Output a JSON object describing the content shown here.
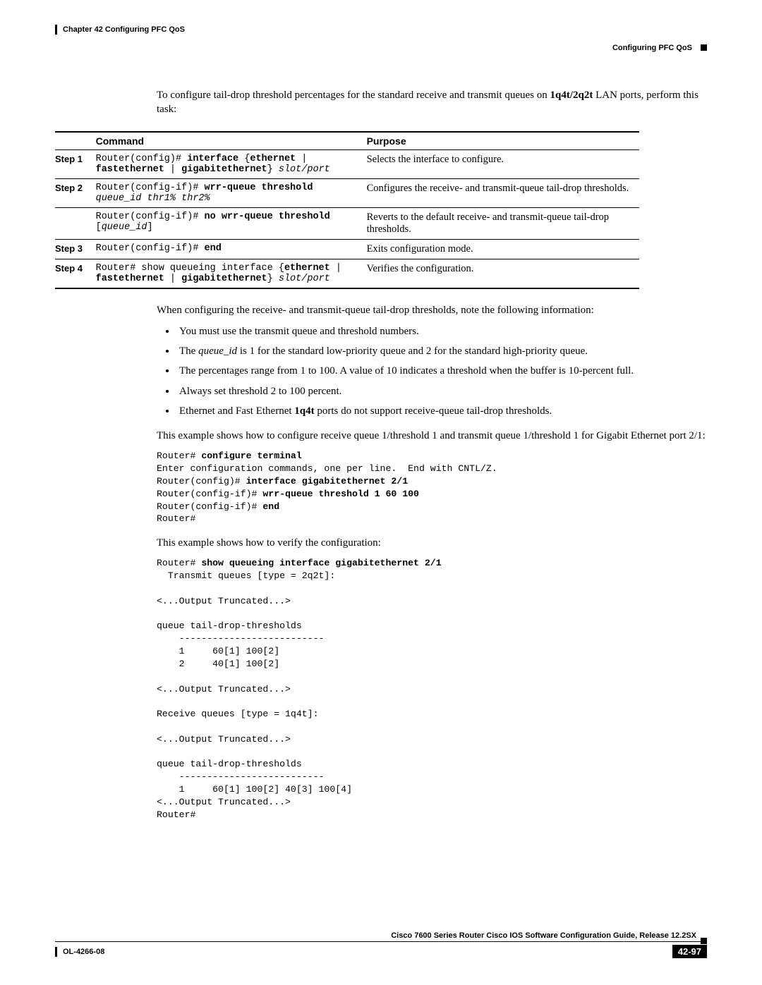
{
  "header": {
    "chapter": "Chapter 42    Configuring PFC QoS",
    "section": "Configuring PFC QoS"
  },
  "intro": {
    "line1_a": "To configure tail-drop threshold percentages for the standard receive and transmit queues on ",
    "line1_b": "1q4t/2q2t",
    "line1_c": " LAN ports, perform this task:"
  },
  "table": {
    "h1": "Command",
    "h2": "Purpose",
    "rows": [
      {
        "step": "Step 1",
        "cmd_parts": [
          "Router(config)# ",
          "interface",
          " {",
          "ethernet",
          " | ",
          "fastethernet",
          " | ",
          "gigabitethernet",
          "} ",
          "slot/port"
        ],
        "cmd_style": [
          "p",
          "b",
          "p",
          "b",
          "p",
          "b",
          "p",
          "b",
          "p",
          "i"
        ],
        "purpose": "Selects the interface to configure."
      },
      {
        "step": "Step 2",
        "cmd_parts": [
          "Router(config-if)# ",
          "wrr-queue threshold",
          " ",
          "queue_id thr1% thr2%"
        ],
        "cmd_style": [
          "p",
          "b",
          "p",
          "i"
        ],
        "purpose": "Configures the receive- and transmit-queue tail-drop thresholds."
      },
      {
        "step": "",
        "cmd_parts": [
          "Router(config-if)# ",
          "no wrr-queue threshold",
          " [",
          "queue_id",
          "]"
        ],
        "cmd_style": [
          "p",
          "b",
          "p",
          "i",
          "p"
        ],
        "purpose": "Reverts to the default receive- and transmit-queue tail-drop thresholds."
      },
      {
        "step": "Step 3",
        "cmd_parts": [
          "Router(config-if)# ",
          "end"
        ],
        "cmd_style": [
          "p",
          "b"
        ],
        "purpose": "Exits configuration mode."
      },
      {
        "step": "Step 4",
        "cmd_parts": [
          "Router# show queueing interface {",
          "ethernet",
          " | ",
          "fastethernet",
          " | ",
          "gigabitethernet",
          "} ",
          "slot/port"
        ],
        "cmd_style": [
          "p",
          "b",
          "p",
          "b",
          "p",
          "b",
          "p",
          "i"
        ],
        "purpose": "Verifies the configuration."
      }
    ]
  },
  "note_intro": "When configuring the receive- and transmit-queue tail-drop thresholds, note the following information:",
  "bullets": {
    "b1": "You must use the transmit queue and threshold numbers.",
    "b2_a": "The ",
    "b2_b": "queue_id",
    "b2_c": " is 1 for the standard low-priority queue and 2 for the standard high-priority queue.",
    "b3": "The percentages range from 1 to 100. A value of 10 indicates a threshold when the buffer is 10-percent full.",
    "b4": "Always set threshold 2 to 100 percent.",
    "b5_a": "Ethernet and Fast Ethernet ",
    "b5_b": "1q4t",
    "b5_c": " ports do not support receive-queue tail-drop thresholds."
  },
  "example1_intro": "This example shows how to configure receive queue 1/threshold 1 and transmit queue 1/threshold 1 for Gigabit Ethernet port 2/1:",
  "example1": {
    "l1a": "Router# ",
    "l1b": "configure terminal",
    "l2": "Enter configuration commands, one per line.  End with CNTL/Z.",
    "l3a": "Router(config)# ",
    "l3b": "interface gigabitethernet 2/1",
    "l4a": "Router(config-if)# ",
    "l4b": "wrr-queue threshold 1 60 100",
    "l5a": "Router(config-if)# ",
    "l5b": "end",
    "l6": "Router# "
  },
  "example2_intro": "This example shows how to verify the configuration:",
  "example2": {
    "l1a": "Router# ",
    "l1b": "show queueing interface gigabitethernet 2/1",
    "rest": "  Transmit queues [type = 2q2t]:\n\n<...Output Truncated...>\n\nqueue tail-drop-thresholds\n    --------------------------\n    1     60[1] 100[2] \n    2     40[1] 100[2] \n\n<...Output Truncated...>\n\nReceive queues [type = 1q4t]:\n\n<...Output Truncated...>\n\nqueue tail-drop-thresholds\n    --------------------------\n    1     60[1] 100[2] 40[3] 100[4] \n<...Output Truncated...>\nRouter#"
  },
  "footer": {
    "guide": "Cisco 7600 Series Router Cisco IOS Software Configuration Guide, Release 12.2SX",
    "doc": "OL-4266-08",
    "page": "42-97"
  }
}
